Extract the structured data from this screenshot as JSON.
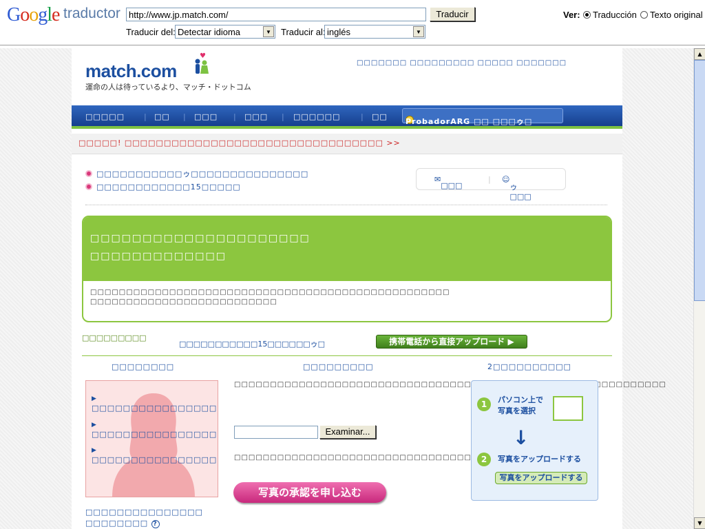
{
  "google_bar": {
    "logo": [
      "G",
      "o",
      "o",
      "g",
      "l",
      "e"
    ],
    "product": "traductor",
    "url_value": "http://www.jp.match.com/",
    "translate_button": "Traducir",
    "from_label": "Traducir del:",
    "from_value": "Detectar idioma",
    "to_label": "Traducir al:",
    "to_value": "inglés",
    "view_label": "Ver:",
    "view_translation": "Traducción",
    "view_original": "Texto original"
  },
  "page": {
    "logo_text": "match.com",
    "tagline": "運命の人は待っているより、マッチ・ドットコム",
    "top_links": "□□□□□□□ □□□□□□□□□ □□□□□ □□□□□□□",
    "nav_items": [
      "□□□□□",
      "□□",
      "□□□",
      "□□□",
      "□□□□□□",
      "□□"
    ],
    "user_button": "ProbadorARG □□ □□□ゥ□",
    "notice": "□□□□□! □□□□□□□□□□□□□□□□□□□□□□□□□□□□□□□□□",
    "notice_more": ">>",
    "bullet_1": "□□□□□□□□□□□ゥ□□□□□□□□□□□□□□□",
    "bullet_2": "□□□□□□□□□□□□15□□□□□",
    "mail_label": "□□□",
    "wink_label": "ゥ□□□",
    "green_title_1": "□□□□□□□□□□□□□□□□□□□□□",
    "green_title_2": "□□□□□□□□□□□□□",
    "green_body_1": "□□□□□□□□□□□□□□□□□□□□□□□□□□□□□□□□□□□□□□□□□□□□□□□□□□",
    "green_body_2": "□□□□□□□□□□□□□□□□□□□□□□□□□□",
    "upload_head": "□□□□□□□□□",
    "upload_sub": "□□□□□□□□□□□15□□□□□□ゥ□",
    "mobile_button": "携帯電話から直接アップロード ▶",
    "col1_head": "□□□□□□□□",
    "col2_head": "□□□□□□□□□",
    "col3_head": "2□□□□□□□□□□",
    "photo_list": [
      "□□□□□□□□□□□□□□□□□",
      "□□□□□□□□□□□□□□□□□",
      "□□□□□□□□□□□□□□□□□"
    ],
    "mid_text_1": "□□□□□□□□□□□□□□□□□□□□□□□□□□□□□□□□□□□□1□□□□□7MB□□□□□□□□□□□□□□□□",
    "browse_button": "Examinar...",
    "mid_text_2": "□□□□□□□□□□□□□□□□□□□□□□□□□□□□□□□□□□□□□□□",
    "pink_button": "写真の承認を申し込む",
    "guide_step1_num": "1",
    "guide_step1": "パソコン上で\n写真を選択",
    "guide_step2_num": "2",
    "guide_step2": "写真をアップロードする",
    "guide_button": "写真をアップロードする",
    "bottom_1": "□□□□□□□□□□□□□□□",
    "bottom_2": "□□□□□□□□",
    "help": "?"
  },
  "colors": {
    "match_blue": "#1c4fa0",
    "green": "#8cc63f",
    "pink": "#d9387a"
  }
}
